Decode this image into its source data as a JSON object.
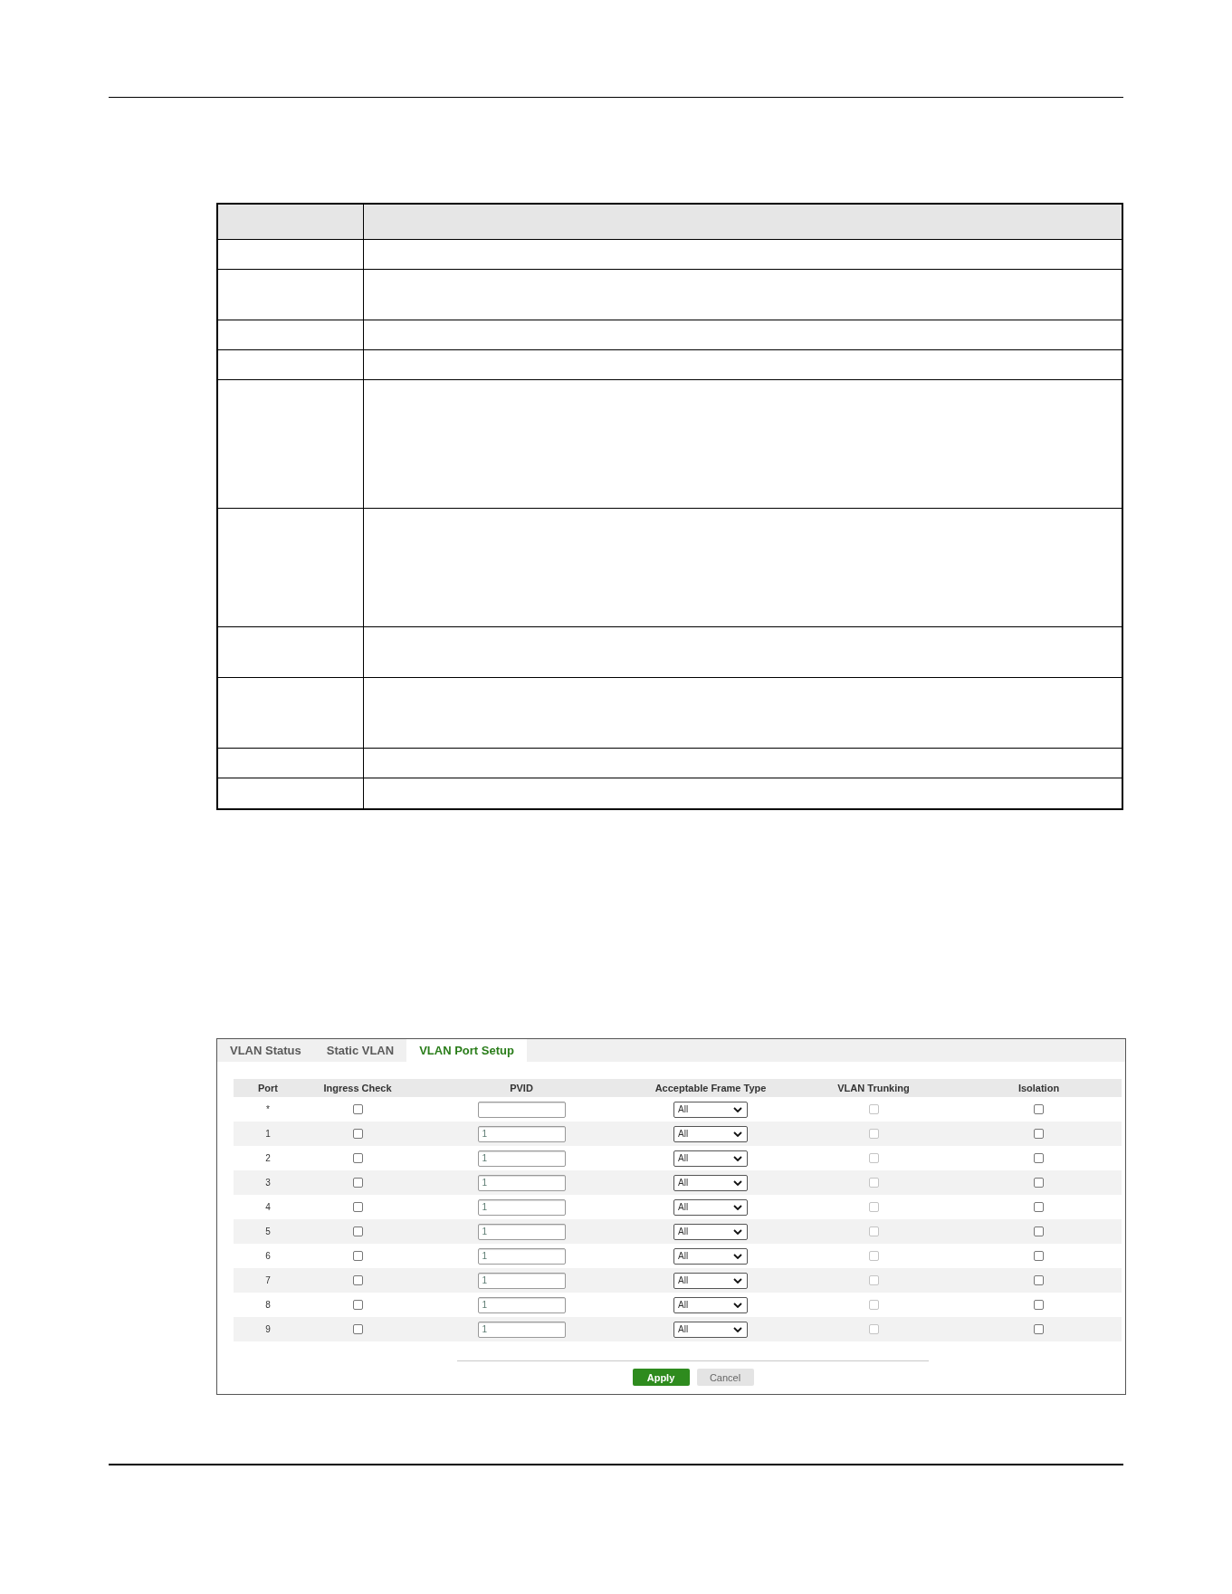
{
  "blank_table": {
    "rows": [
      {
        "kind": "one-line"
      },
      {
        "kind": "two-line"
      },
      {
        "kind": "one-line"
      },
      {
        "kind": "one-line"
      },
      {
        "kind": "six-line"
      },
      {
        "kind": "five-line"
      },
      {
        "kind": "two-line"
      },
      {
        "kind": "three-line"
      },
      {
        "kind": "one-line"
      },
      {
        "kind": "one-line"
      }
    ]
  },
  "vlan_panel": {
    "tabs": [
      {
        "label": "VLAN Status",
        "selected": false
      },
      {
        "label": "Static VLAN",
        "selected": false
      },
      {
        "label": "VLAN Port Setup",
        "selected": true
      }
    ],
    "table": {
      "columns": [
        "Port",
        "Ingress Check",
        "PVID",
        "Acceptable Frame Type",
        "VLAN Trunking",
        "Isolation"
      ],
      "rows": [
        {
          "port": "*",
          "ingress_check": {
            "checked": false,
            "disabled": false
          },
          "frame_type": "All",
          "vlan_trunking": {
            "checked": false,
            "disabled": true
          },
          "isolation": {
            "checked": false,
            "disabled": false
          }
        },
        {
          "port": "1",
          "ingress_check": {
            "checked": false,
            "disabled": false
          },
          "pvid": "1",
          "frame_type": "All",
          "vlan_trunking": {
            "checked": false,
            "disabled": true
          },
          "isolation": {
            "checked": false,
            "disabled": false
          }
        },
        {
          "port": "2",
          "ingress_check": {
            "checked": false,
            "disabled": false
          },
          "pvid": "1",
          "frame_type": "All",
          "vlan_trunking": {
            "checked": false,
            "disabled": true
          },
          "isolation": {
            "checked": false,
            "disabled": false
          }
        },
        {
          "port": "3",
          "ingress_check": {
            "checked": false,
            "disabled": false
          },
          "pvid": "1",
          "frame_type": "All",
          "vlan_trunking": {
            "checked": false,
            "disabled": true
          },
          "isolation": {
            "checked": false,
            "disabled": false
          }
        },
        {
          "port": "4",
          "ingress_check": {
            "checked": false,
            "disabled": false
          },
          "pvid": "1",
          "frame_type": "All",
          "vlan_trunking": {
            "checked": false,
            "disabled": true
          },
          "isolation": {
            "checked": false,
            "disabled": false
          }
        },
        {
          "port": "5",
          "ingress_check": {
            "checked": false,
            "disabled": false
          },
          "pvid": "1",
          "frame_type": "All",
          "vlan_trunking": {
            "checked": false,
            "disabled": true
          },
          "isolation": {
            "checked": false,
            "disabled": false
          }
        },
        {
          "port": "6",
          "ingress_check": {
            "checked": false,
            "disabled": false
          },
          "pvid": "1",
          "frame_type": "All",
          "vlan_trunking": {
            "checked": false,
            "disabled": true
          },
          "isolation": {
            "checked": false,
            "disabled": false
          }
        },
        {
          "port": "7",
          "ingress_check": {
            "checked": false,
            "disabled": false
          },
          "pvid": "1",
          "frame_type": "All",
          "vlan_trunking": {
            "checked": false,
            "disabled": true
          },
          "isolation": {
            "checked": false,
            "disabled": false
          }
        },
        {
          "port": "8",
          "ingress_check": {
            "checked": false,
            "disabled": false
          },
          "pvid": "1",
          "frame_type": "All",
          "vlan_trunking": {
            "checked": false,
            "disabled": true
          },
          "isolation": {
            "checked": false,
            "disabled": false
          }
        },
        {
          "port": "9",
          "ingress_check": {
            "checked": false,
            "disabled": false
          },
          "pvid": "1",
          "frame_type": "All",
          "vlan_trunking": {
            "checked": false,
            "disabled": true
          },
          "isolation": {
            "checked": false,
            "disabled": false
          }
        }
      ]
    },
    "buttons": [
      {
        "label": "Apply",
        "kind": "primary"
      },
      {
        "label": "Cancel",
        "kind": "secondary"
      }
    ]
  }
}
